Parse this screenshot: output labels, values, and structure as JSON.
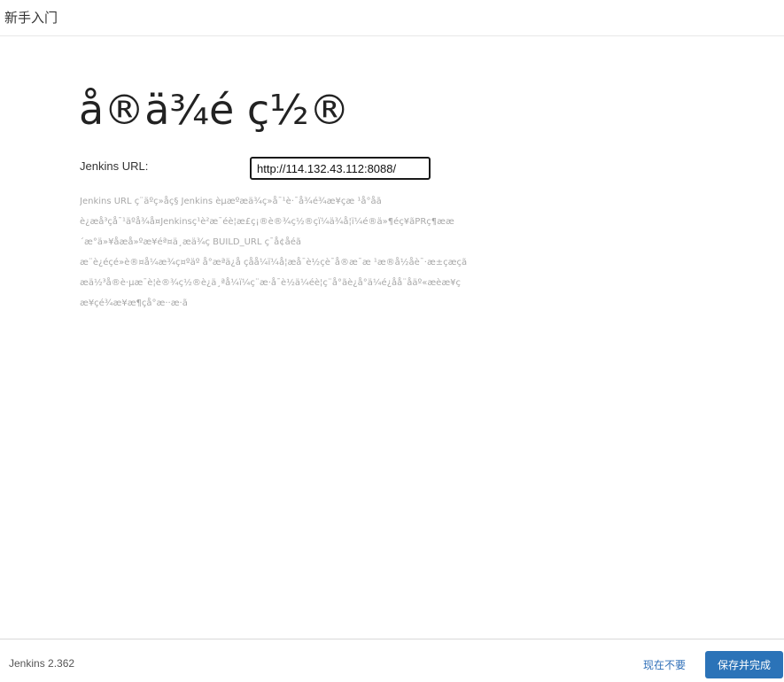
{
  "header": {
    "title": "新手入门"
  },
  "main": {
    "page_title": "å®ä¾é ç½®",
    "url_label": "Jenkins URL:",
    "url_value": "http://114.132.43.112:8088/",
    "help_lines": [
      "Jenkins URL ç¨äºç»åç§ Jenkins èµæºæä¾ç»å¯¹è·¯å¾é¾æ¥çæ ¹å°åã",
      "è¿æå³çå¯¹äºå¾å¤Jenkinsç¹è²æ¯éè¦æ­£ç¡®è®¾ç½®çï¼ä¾å¦ï¼é®ä»¶éç¥ãPRç¶ææ",
      "´æ°ä»¥åæå»ºæ­¥éª¤ä¸­æä¾ç BUILD_URL ç¯å¢åéã",
      "æ¨è¿éçé»è®¤å¼æ¾ç¤ºäº å°æªä¿å­ çåå¼ï¼å¦æå¯è½çè¯å®æ¯æ ¹æ®å½åè¯·æ±çæçã",
      "æä½³å®è·µæ¯è¦è®¾ç½®è¿ä¸ªå¼ï¼ç¨æ·å¯è½ä¼éè¦ç¨å°ãè¿å°ä¼é¿åå¨åäº«æèæ¥ç",
      "æ¥çé¾æ¥æ¶çå°æ··æ·ã"
    ]
  },
  "footer": {
    "version": "Jenkins 2.362",
    "skip_label": "现在不要",
    "finish_label": "保存并完成"
  }
}
